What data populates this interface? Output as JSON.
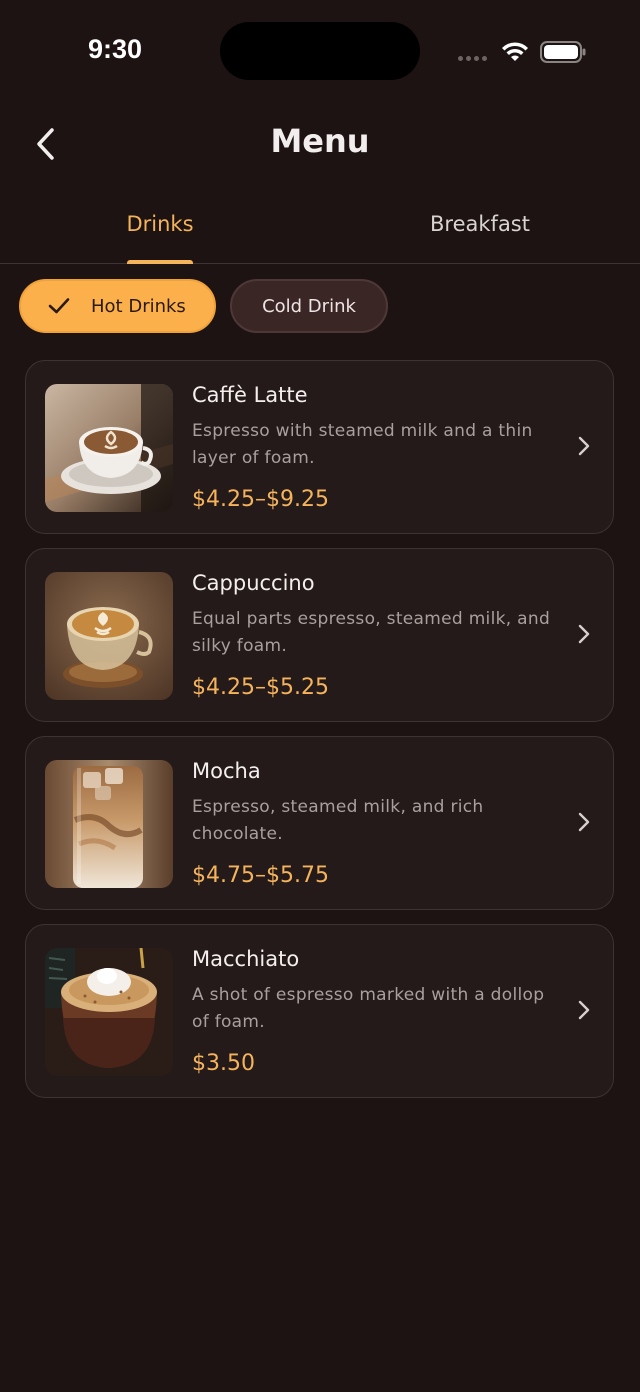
{
  "status_bar": {
    "time": "9:30"
  },
  "header": {
    "title": "Menu"
  },
  "tabs": [
    {
      "label": "Drinks",
      "active": true
    },
    {
      "label": "Breakfast",
      "active": false
    }
  ],
  "filters": [
    {
      "label": "Hot Drinks",
      "selected": true
    },
    {
      "label": "Cold Drink",
      "selected": false
    }
  ],
  "items": [
    {
      "name": "Caffè Latte",
      "description": "Espresso with steamed milk and a thin layer of foam.",
      "price": "$4.25–$9.25"
    },
    {
      "name": "Cappuccino",
      "description": "Equal parts espresso, steamed milk, and silky foam.",
      "price": "$4.25–$5.25"
    },
    {
      "name": "Mocha",
      "description": "Espresso, steamed milk, and rich chocolate.",
      "price": "$4.75–$5.75"
    },
    {
      "name": "Macchiato",
      "description": "A shot of espresso marked with a dollop of foam.",
      "price": "$3.50"
    }
  ],
  "colors": {
    "background": "#1c1312",
    "accent": "#f5b35c",
    "card": "#231a19",
    "chip_selected": "#fbb04c",
    "chip_unselected": "#3a2625"
  }
}
